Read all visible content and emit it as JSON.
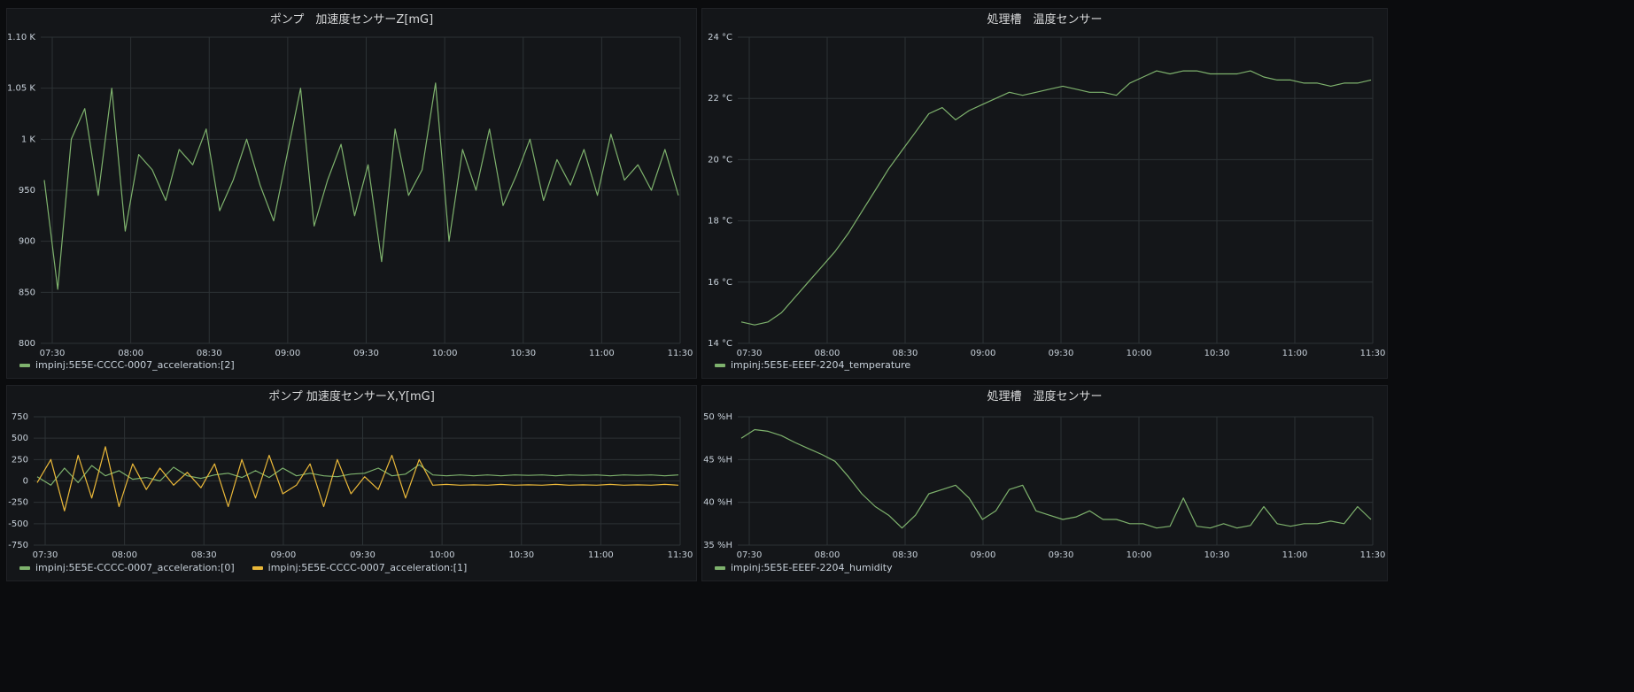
{
  "colors": {
    "green": "#7eb26d",
    "yellow": "#eab839",
    "grid": "#2c3235",
    "text": "#c7d0d9"
  },
  "chart_data": [
    {
      "id": "p1",
      "type": "line",
      "title": "ポンプ　加速度センサーZ[mG]",
      "ylim": [
        800,
        1100
      ],
      "yticks": [
        800,
        850,
        900,
        950,
        1000,
        1050,
        1100
      ],
      "ytick_labels": [
        "800",
        "850",
        "900",
        "950",
        "1 K",
        "1.05 K",
        "1.10 K"
      ],
      "x": [
        "07:30",
        "08:00",
        "08:30",
        "09:00",
        "09:30",
        "10:00",
        "10:30",
        "11:00",
        "11:30"
      ],
      "series": [
        {
          "name": "impinj:5E5E-CCCC-0007_acceleration:[2]",
          "color": "#7eb26d",
          "values": [
            960,
            853,
            1000,
            1030,
            945,
            1050,
            910,
            985,
            970,
            940,
            990,
            975,
            1010,
            930,
            960,
            1000,
            955,
            920,
            985,
            1050,
            915,
            960,
            995,
            925,
            975,
            880,
            1010,
            945,
            970,
            1055,
            900,
            990,
            950,
            1010,
            935,
            965,
            1000,
            940,
            980,
            955,
            990,
            945,
            1005,
            960,
            975,
            950,
            990,
            945
          ]
        }
      ]
    },
    {
      "id": "p2",
      "type": "line",
      "title": "処理槽　温度センサー",
      "ylim": [
        14,
        24
      ],
      "yticks": [
        14,
        16,
        18,
        20,
        22,
        24
      ],
      "ytick_labels": [
        "14 °C",
        "16 °C",
        "18 °C",
        "20 °C",
        "22 °C",
        "24 °C"
      ],
      "x": [
        "07:30",
        "08:00",
        "08:30",
        "09:00",
        "09:30",
        "10:00",
        "10:30",
        "11:00",
        "11:30"
      ],
      "series": [
        {
          "name": "impinj:5E5E-EEEF-2204_temperature",
          "color": "#7eb26d",
          "values": [
            14.7,
            14.6,
            14.7,
            15.0,
            15.5,
            16.0,
            16.5,
            17.0,
            17.6,
            18.3,
            19.0,
            19.7,
            20.3,
            20.9,
            21.5,
            21.7,
            21.3,
            21.6,
            21.8,
            22.0,
            22.2,
            22.1,
            22.2,
            22.3,
            22.4,
            22.3,
            22.2,
            22.2,
            22.1,
            22.5,
            22.7,
            22.9,
            22.8,
            22.9,
            22.9,
            22.8,
            22.8,
            22.8,
            22.9,
            22.7,
            22.6,
            22.6,
            22.5,
            22.5,
            22.4,
            22.5,
            22.5,
            22.6
          ]
        }
      ]
    },
    {
      "id": "p3",
      "type": "line",
      "title": "ポンプ 加速度センサーX,Y[mG]",
      "ylim": [
        -750,
        750
      ],
      "yticks": [
        -750,
        -500,
        -250,
        0,
        250,
        500,
        750
      ],
      "ytick_labels": [
        "-750",
        "-500",
        "-250",
        "0",
        "250",
        "500",
        "750"
      ],
      "x": [
        "07:30",
        "08:00",
        "08:30",
        "09:00",
        "09:30",
        "10:00",
        "10:30",
        "11:00",
        "11:30"
      ],
      "series": [
        {
          "name": "impinj:5E5E-CCCC-0007_acceleration:[0]",
          "color": "#7eb26d",
          "values": [
            50,
            -50,
            150,
            -20,
            180,
            60,
            120,
            20,
            40,
            0,
            160,
            60,
            30,
            70,
            90,
            40,
            120,
            40,
            150,
            60,
            90,
            60,
            50,
            80,
            90,
            150,
            60,
            80,
            190,
            70,
            60,
            70,
            60,
            70,
            60,
            70,
            65,
            70,
            60,
            70,
            65,
            70,
            60,
            70,
            65,
            70,
            60,
            70
          ]
        },
        {
          "name": "impinj:5E5E-CCCC-0007_acceleration:[1]",
          "color": "#eab839",
          "values": [
            -20,
            250,
            -350,
            300,
            -200,
            400,
            -300,
            200,
            -100,
            150,
            -50,
            100,
            -80,
            200,
            -300,
            250,
            -200,
            300,
            -150,
            -50,
            200,
            -300,
            250,
            -150,
            50,
            -100,
            300,
            -200,
            250,
            -50,
            -40,
            -50,
            -45,
            -50,
            -40,
            -50,
            -45,
            -50,
            -40,
            -50,
            -45,
            -50,
            -40,
            -50,
            -45,
            -50,
            -40,
            -50
          ]
        }
      ]
    },
    {
      "id": "p4",
      "type": "line",
      "title": "処理槽　湿度センサー",
      "ylim": [
        35,
        50
      ],
      "yticks": [
        35,
        40,
        45,
        50
      ],
      "ytick_labels": [
        "35 %H",
        "40 %H",
        "45 %H",
        "50 %H"
      ],
      "x": [
        "07:30",
        "08:00",
        "08:30",
        "09:00",
        "09:30",
        "10:00",
        "10:30",
        "11:00",
        "11:30"
      ],
      "series": [
        {
          "name": "impinj:5E5E-EEEF-2204_humidity",
          "color": "#7eb26d",
          "values": [
            47.5,
            48.5,
            48.3,
            47.8,
            47.0,
            46.3,
            45.6,
            44.8,
            43.0,
            41.0,
            39.5,
            38.5,
            37.0,
            38.5,
            41.0,
            41.5,
            42.0,
            40.5,
            38.0,
            39.0,
            41.5,
            42.0,
            39.0,
            38.5,
            38.0,
            38.3,
            39.0,
            38.0,
            38.0,
            37.5,
            37.5,
            37.0,
            37.2,
            40.5,
            37.2,
            37.0,
            37.5,
            37.0,
            37.3,
            39.5,
            37.5,
            37.2,
            37.5,
            37.5,
            37.8,
            37.5,
            39.5,
            38.0
          ]
        }
      ]
    }
  ]
}
